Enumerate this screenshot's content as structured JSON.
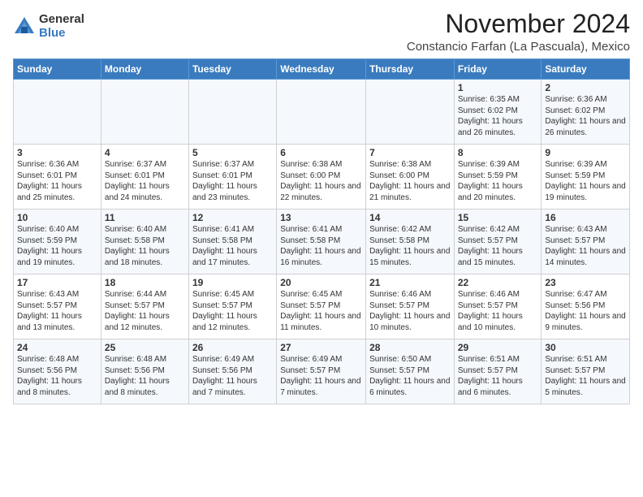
{
  "logo": {
    "general": "General",
    "blue": "Blue"
  },
  "header": {
    "month": "November 2024",
    "location": "Constancio Farfan (La Pascuala), Mexico"
  },
  "weekdays": [
    "Sunday",
    "Monday",
    "Tuesday",
    "Wednesday",
    "Thursday",
    "Friday",
    "Saturday"
  ],
  "rows": [
    [
      {
        "day": "",
        "info": ""
      },
      {
        "day": "",
        "info": ""
      },
      {
        "day": "",
        "info": ""
      },
      {
        "day": "",
        "info": ""
      },
      {
        "day": "",
        "info": ""
      },
      {
        "day": "1",
        "info": "Sunrise: 6:35 AM\nSunset: 6:02 PM\nDaylight: 11 hours and 26 minutes."
      },
      {
        "day": "2",
        "info": "Sunrise: 6:36 AM\nSunset: 6:02 PM\nDaylight: 11 hours and 26 minutes."
      }
    ],
    [
      {
        "day": "3",
        "info": "Sunrise: 6:36 AM\nSunset: 6:01 PM\nDaylight: 11 hours and 25 minutes."
      },
      {
        "day": "4",
        "info": "Sunrise: 6:37 AM\nSunset: 6:01 PM\nDaylight: 11 hours and 24 minutes."
      },
      {
        "day": "5",
        "info": "Sunrise: 6:37 AM\nSunset: 6:01 PM\nDaylight: 11 hours and 23 minutes."
      },
      {
        "day": "6",
        "info": "Sunrise: 6:38 AM\nSunset: 6:00 PM\nDaylight: 11 hours and 22 minutes."
      },
      {
        "day": "7",
        "info": "Sunrise: 6:38 AM\nSunset: 6:00 PM\nDaylight: 11 hours and 21 minutes."
      },
      {
        "day": "8",
        "info": "Sunrise: 6:39 AM\nSunset: 5:59 PM\nDaylight: 11 hours and 20 minutes."
      },
      {
        "day": "9",
        "info": "Sunrise: 6:39 AM\nSunset: 5:59 PM\nDaylight: 11 hours and 19 minutes."
      }
    ],
    [
      {
        "day": "10",
        "info": "Sunrise: 6:40 AM\nSunset: 5:59 PM\nDaylight: 11 hours and 19 minutes."
      },
      {
        "day": "11",
        "info": "Sunrise: 6:40 AM\nSunset: 5:58 PM\nDaylight: 11 hours and 18 minutes."
      },
      {
        "day": "12",
        "info": "Sunrise: 6:41 AM\nSunset: 5:58 PM\nDaylight: 11 hours and 17 minutes."
      },
      {
        "day": "13",
        "info": "Sunrise: 6:41 AM\nSunset: 5:58 PM\nDaylight: 11 hours and 16 minutes."
      },
      {
        "day": "14",
        "info": "Sunrise: 6:42 AM\nSunset: 5:58 PM\nDaylight: 11 hours and 15 minutes."
      },
      {
        "day": "15",
        "info": "Sunrise: 6:42 AM\nSunset: 5:57 PM\nDaylight: 11 hours and 15 minutes."
      },
      {
        "day": "16",
        "info": "Sunrise: 6:43 AM\nSunset: 5:57 PM\nDaylight: 11 hours and 14 minutes."
      }
    ],
    [
      {
        "day": "17",
        "info": "Sunrise: 6:43 AM\nSunset: 5:57 PM\nDaylight: 11 hours and 13 minutes."
      },
      {
        "day": "18",
        "info": "Sunrise: 6:44 AM\nSunset: 5:57 PM\nDaylight: 11 hours and 12 minutes."
      },
      {
        "day": "19",
        "info": "Sunrise: 6:45 AM\nSunset: 5:57 PM\nDaylight: 11 hours and 12 minutes."
      },
      {
        "day": "20",
        "info": "Sunrise: 6:45 AM\nSunset: 5:57 PM\nDaylight: 11 hours and 11 minutes."
      },
      {
        "day": "21",
        "info": "Sunrise: 6:46 AM\nSunset: 5:57 PM\nDaylight: 11 hours and 10 minutes."
      },
      {
        "day": "22",
        "info": "Sunrise: 6:46 AM\nSunset: 5:57 PM\nDaylight: 11 hours and 10 minutes."
      },
      {
        "day": "23",
        "info": "Sunrise: 6:47 AM\nSunset: 5:56 PM\nDaylight: 11 hours and 9 minutes."
      }
    ],
    [
      {
        "day": "24",
        "info": "Sunrise: 6:48 AM\nSunset: 5:56 PM\nDaylight: 11 hours and 8 minutes."
      },
      {
        "day": "25",
        "info": "Sunrise: 6:48 AM\nSunset: 5:56 PM\nDaylight: 11 hours and 8 minutes."
      },
      {
        "day": "26",
        "info": "Sunrise: 6:49 AM\nSunset: 5:56 PM\nDaylight: 11 hours and 7 minutes."
      },
      {
        "day": "27",
        "info": "Sunrise: 6:49 AM\nSunset: 5:57 PM\nDaylight: 11 hours and 7 minutes."
      },
      {
        "day": "28",
        "info": "Sunrise: 6:50 AM\nSunset: 5:57 PM\nDaylight: 11 hours and 6 minutes."
      },
      {
        "day": "29",
        "info": "Sunrise: 6:51 AM\nSunset: 5:57 PM\nDaylight: 11 hours and 6 minutes."
      },
      {
        "day": "30",
        "info": "Sunrise: 6:51 AM\nSunset: 5:57 PM\nDaylight: 11 hours and 5 minutes."
      }
    ]
  ]
}
